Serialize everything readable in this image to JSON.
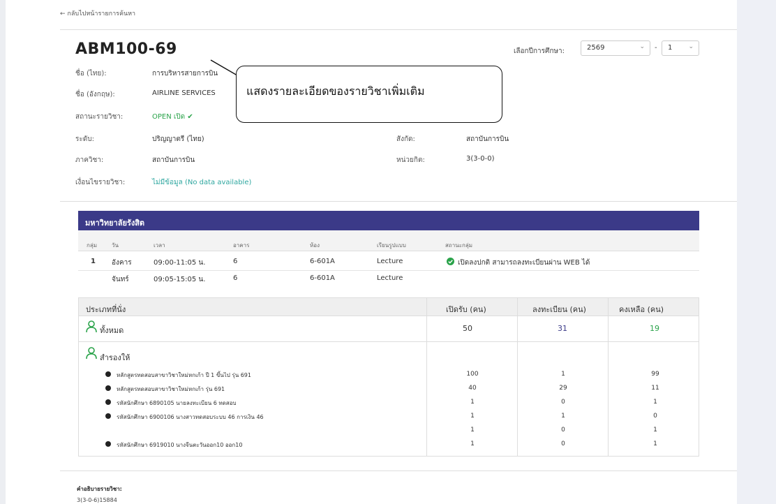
{
  "nav": {
    "back_label": "← กลับไปหน้ารายการค้นหา"
  },
  "course": {
    "code": "ABM100-69",
    "fields": [
      {
        "label": "ชื่อ (ไทย):",
        "value": "การบริหารสายการบิน"
      },
      {
        "label": "ชื่อ (อังกฤษ):",
        "value": "AIRLINE SERVICES"
      },
      {
        "label": "สถานะรายวิชา:",
        "value": "OPEN เปิด ✔"
      },
      {
        "label": "ระดับ:",
        "value": "ปริญญาตรี (ไทย)"
      },
      {
        "label": "ภาควิชา:",
        "value": "สถาบันการบิน"
      },
      {
        "label": "เงื่อนไขรายวิชา:",
        "value": "ไม่มีข้อมูล (No data available)"
      }
    ],
    "right_fields": [
      {
        "label": "สังกัด:",
        "value": "สถาบันการบิน"
      },
      {
        "label": "หน่วยกิต:",
        "value": "3(3-0-0)"
      }
    ]
  },
  "year_select": {
    "label": "เลือกปีการศึกษา:",
    "year": "2569",
    "semester": "1",
    "separator": "-"
  },
  "callout": {
    "text": "แสดงรายละเอียดของรายวิชาเพิ่มเติม"
  },
  "university": {
    "name": "มหาวิทยาลัยรังสิต"
  },
  "schedule": {
    "headers": [
      "กลุ่ม",
      "วัน",
      "เวลา",
      "อาคาร",
      "ห้อง",
      "เรียนรูปแบบ",
      "สถานะกลุ่ม"
    ],
    "rows": [
      {
        "group": "1",
        "day": "อังคาร",
        "time": "09:00-11:05 น.",
        "building": "6",
        "room": "6-601A",
        "mode": "Lecture",
        "status": "เปิดลงปกติ สามารถลงทะเบียนผ่าน WEB ได้"
      },
      {
        "group": "",
        "day": "จันทร์",
        "time": "09:05-15:05 น.",
        "building": "6",
        "room": "6-601A",
        "mode": "Lecture",
        "status": ""
      }
    ]
  },
  "seats": {
    "headers": [
      "ประเภทที่นั่ง",
      "เปิดรับ (คน)",
      "ลงทะเบียน (คน)",
      "คงเหลือ (คน)"
    ],
    "total": {
      "label": "ทั้งหมด",
      "open": "50",
      "registered": "31",
      "remaining": "19"
    },
    "reserved_label": "สำรองให้",
    "reserved": [
      {
        "label": "หลักสูตรทดสอบสาขาวิชาใหม่หกเก้า ปี 1 ขึ้นไป รุ่น 691",
        "open": "100",
        "registered": "1",
        "remaining": "99"
      },
      {
        "label": "หลักสูตรทดสอบสาขาวิชาใหม่หกเก้า รุ่น 691",
        "open": "40",
        "registered": "29",
        "remaining": "11"
      },
      {
        "label": "รหัสนักศึกษา 6890105 นายลงทะเบียน 6 ทดสอบ",
        "open": "1",
        "registered": "0",
        "remaining": "1"
      },
      {
        "label": "รหัสนักศึกษา 6900106 นางสาวทดสอบระบบ 46 การเงิน 46",
        "open": "1",
        "registered": "1",
        "remaining": "0"
      },
      {
        "label": "",
        "open": "1",
        "registered": "0",
        "remaining": "1"
      },
      {
        "label": "รหัสนักศึกษา 6919010 นางจีนตะวันออก10 ออก10",
        "open": "1",
        "registered": "0",
        "remaining": "1"
      }
    ]
  },
  "description": {
    "title": "คำอธิบายรายวิชา:",
    "value": "3(3-0-6)15884"
  },
  "colors": {
    "header_bar": "#3b3a88",
    "green": "#2aa34a",
    "blue": "#3b3a88",
    "teal": "#2fa7a0"
  }
}
